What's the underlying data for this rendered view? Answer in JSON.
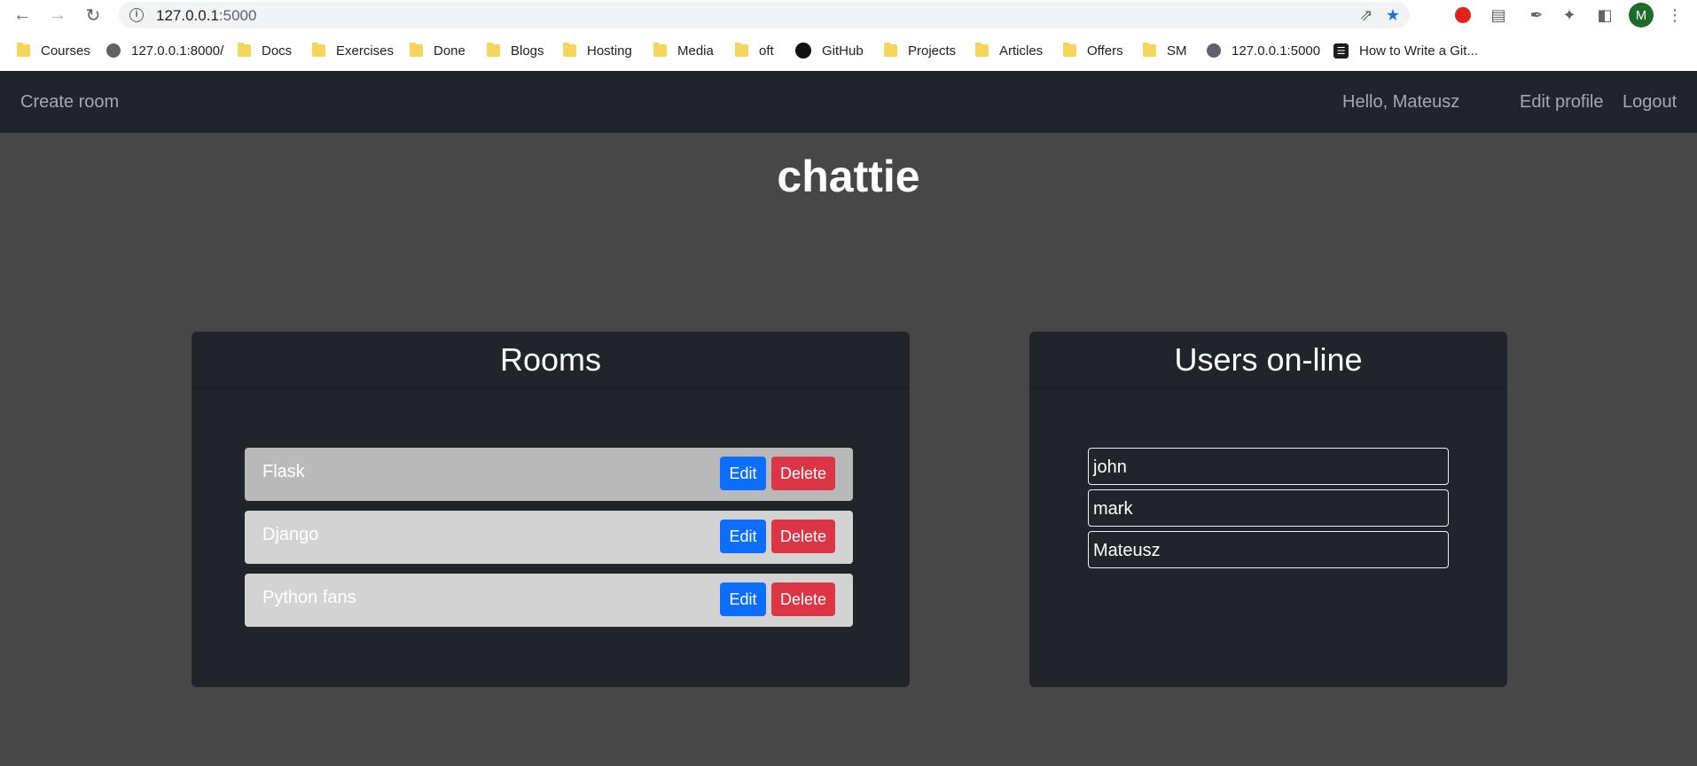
{
  "browser": {
    "url_host": "127.0.0.1",
    "url_port": ":5000",
    "bookmarks": [
      {
        "label": "Courses",
        "icon": "folder-icon"
      },
      {
        "label": "127.0.0.1:8000/",
        "icon": "globe-icon"
      },
      {
        "label": "Docs",
        "icon": "folder-icon"
      },
      {
        "label": "Exercises",
        "icon": "folder-icon"
      },
      {
        "label": "Done",
        "icon": "folder-icon"
      },
      {
        "label": "Blogs",
        "icon": "folder-icon"
      },
      {
        "label": "Hosting",
        "icon": "folder-icon"
      },
      {
        "label": "Media",
        "icon": "folder-icon"
      },
      {
        "label": "oft",
        "icon": "folder-icon"
      },
      {
        "label": "GitHub",
        "icon": "github-icon"
      },
      {
        "label": "Projects",
        "icon": "folder-icon"
      },
      {
        "label": "Articles",
        "icon": "folder-icon"
      },
      {
        "label": "Offers",
        "icon": "folder-icon"
      },
      {
        "label": "SM",
        "icon": "folder-icon"
      },
      {
        "label": "127.0.0.1:5000",
        "icon": "globe-icon"
      },
      {
        "label": "How to Write a Git...",
        "icon": "page-icon"
      }
    ],
    "avatar_letter": "M"
  },
  "navbar": {
    "create_room": "Create room",
    "greeting": "Hello, Mateusz",
    "edit_profile": "Edit profile",
    "logout": "Logout"
  },
  "app_title": "chattie",
  "rooms": {
    "header": "Rooms",
    "edit_label": "Edit",
    "delete_label": "Delete",
    "items": [
      {
        "name": "Flask"
      },
      {
        "name": "Django"
      },
      {
        "name": "Python fans"
      }
    ]
  },
  "users": {
    "header": "Users on-line",
    "items": [
      {
        "name": "john"
      },
      {
        "name": "mark"
      },
      {
        "name": "Mateusz"
      }
    ]
  },
  "colors": {
    "page_bg": "#474747",
    "panel_bg": "#212529",
    "edit_button": "#0d6efd",
    "delete_button": "#dc3545"
  }
}
